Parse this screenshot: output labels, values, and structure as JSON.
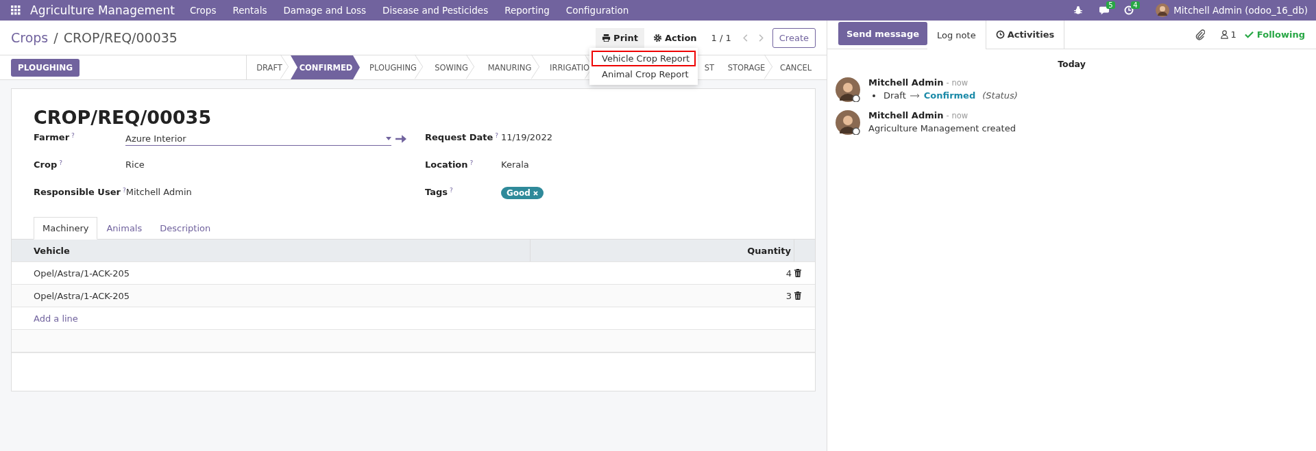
{
  "navbar": {
    "app_name": "Agriculture Management",
    "menus": [
      "Crops",
      "Rentals",
      "Damage and Loss",
      "Disease and Pesticides",
      "Reporting",
      "Configuration"
    ],
    "messages_count": "5",
    "activities_count": "4",
    "user": "Mitchell Admin (odoo_16_db)"
  },
  "control_panel": {
    "breadcrumb": [
      "Crops",
      "CROP/REQ/00035"
    ],
    "separator": "/",
    "print": "Print",
    "action": "Action",
    "pager": "1 / 1",
    "create": "Create"
  },
  "print_menu": [
    {
      "label": "Vehicle Crop Report",
      "highlighted": true
    },
    {
      "label": "Animal Crop Report",
      "highlighted": false
    }
  ],
  "statusbar": {
    "buttons": [
      "PLOUGHING"
    ],
    "stages": [
      {
        "label": "DRAFT",
        "selected": false
      },
      {
        "label": "CONFIRMED",
        "selected": true
      },
      {
        "label": "PLOUGHING",
        "selected": false
      },
      {
        "label": "SOWING",
        "selected": false
      },
      {
        "label": "MANURING",
        "selected": false
      },
      {
        "label": "IRRIGATIO",
        "selected": false
      },
      {
        "label": "ST",
        "selected": false
      },
      {
        "label": "STORAGE",
        "selected": false
      },
      {
        "label": "CANCEL",
        "selected": false
      }
    ]
  },
  "form": {
    "title": "CROP/REQ/00035",
    "left_fields": [
      {
        "label": "Farmer",
        "help": "?",
        "kind": "many2one",
        "value": "Azure Interior"
      },
      {
        "label": "Crop",
        "help": "?",
        "kind": "text",
        "value": "Rice"
      },
      {
        "label": "Responsible User",
        "help": "?",
        "kind": "text",
        "value": "Mitchell Admin"
      }
    ],
    "right_fields": [
      {
        "label": "Request Date",
        "help": "?",
        "kind": "text",
        "value": "11/19/2022"
      },
      {
        "label": "Location",
        "help": "?",
        "kind": "text",
        "value": "Kerala"
      },
      {
        "label": "Tags",
        "help": "?",
        "kind": "tags",
        "tags": [
          "Good"
        ]
      }
    ],
    "tabs": [
      {
        "label": "Machinery",
        "selected": true
      },
      {
        "label": "Animals",
        "selected": false
      },
      {
        "label": "Description",
        "selected": false
      }
    ],
    "table": {
      "columns": [
        "Vehicle",
        "Quantity"
      ],
      "rows": [
        {
          "vehicle": "Opel/Astra/1-ACK-205",
          "quantity": "4"
        },
        {
          "vehicle": "Opel/Astra/1-ACK-205",
          "quantity": "3"
        }
      ],
      "add_line": "Add a line"
    }
  },
  "chatter": {
    "tabs": [
      {
        "label": "Send message",
        "kind": "primary",
        "selected": false
      },
      {
        "label": "Log note",
        "kind": "tab",
        "selected": true
      },
      {
        "label": "Activities",
        "kind": "tab",
        "selected": false
      }
    ],
    "followers_count": "1",
    "following": "Following",
    "date": "Today",
    "messages": [
      {
        "author": "Mitchell Admin",
        "time": "- now",
        "kind": "tracking",
        "old": "Draft",
        "new": "Confirmed",
        "field": "(Status)"
      },
      {
        "author": "Mitchell Admin",
        "time": "- now",
        "kind": "note",
        "body": "Agriculture Management created"
      }
    ]
  }
}
